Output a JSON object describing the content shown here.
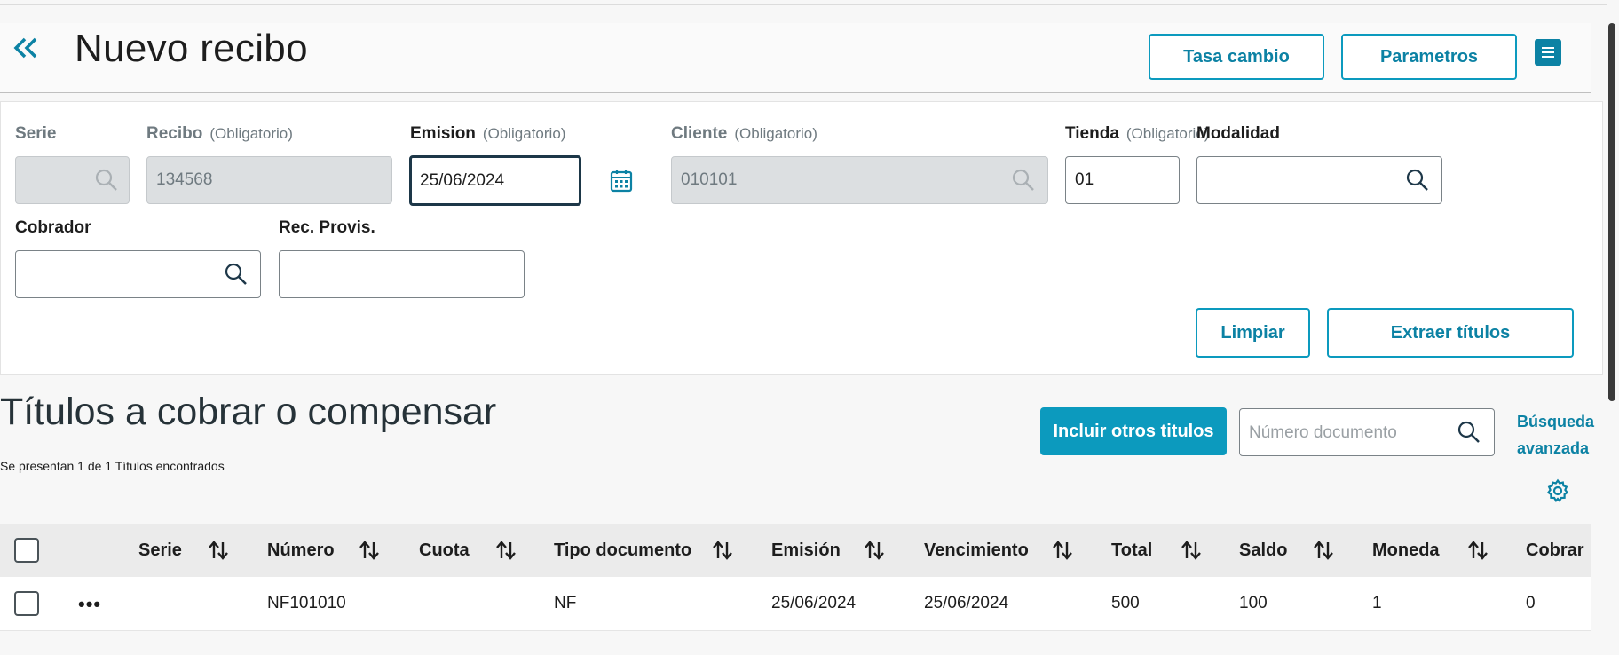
{
  "header": {
    "title": "Nuevo recibo",
    "tasa_label": "Tasa cambio",
    "param_label": "Parametros"
  },
  "form": {
    "serie": {
      "label": "Serie",
      "value": ""
    },
    "recibo": {
      "label": "Recibo",
      "opt": "(Obligatorio)",
      "value": "134568"
    },
    "emision": {
      "label": "Emision",
      "opt": "(Obligatorio)",
      "value": "25/06/2024"
    },
    "cliente": {
      "label": "Cliente",
      "opt": "(Obligatorio)",
      "value": "010101"
    },
    "tienda": {
      "label": "Tienda",
      "opt": "(Obligatorio)",
      "value": "01"
    },
    "modalidad": {
      "label": "Modalidad",
      "value": ""
    },
    "cobrador": {
      "label": "Cobrador",
      "value": ""
    },
    "recprov": {
      "label": "Rec. Provis.",
      "value": ""
    },
    "limpiar_label": "Limpiar",
    "extraer_label": "Extraer títulos"
  },
  "section": {
    "title": "Títulos a cobrar o compensar",
    "result_text": "Se presentan 1 de 1 Títulos encontrados",
    "include_label": "Incluir otros titulos",
    "search_placeholder": "Número documento",
    "adv_line1": "Búsqueda",
    "adv_line2": "avanzada"
  },
  "table": {
    "columns": [
      "Serie",
      "Número",
      "Cuota",
      "Tipo documento",
      "Emisión",
      "Vencimiento",
      "Total",
      "Saldo",
      "Moneda",
      "Cobrar"
    ],
    "rows": [
      {
        "serie": "",
        "numero": "NF101010",
        "cuota": "",
        "tipo": "NF",
        "emision": "25/06/2024",
        "vencimiento": "25/06/2024",
        "total": "500",
        "saldo": "100",
        "moneda": "1",
        "cobrar": "0"
      }
    ]
  },
  "colors": {
    "accent": "#0c9abe",
    "accent_dark": "#0c82a4",
    "disabled_bg": "#dcdfe1"
  }
}
